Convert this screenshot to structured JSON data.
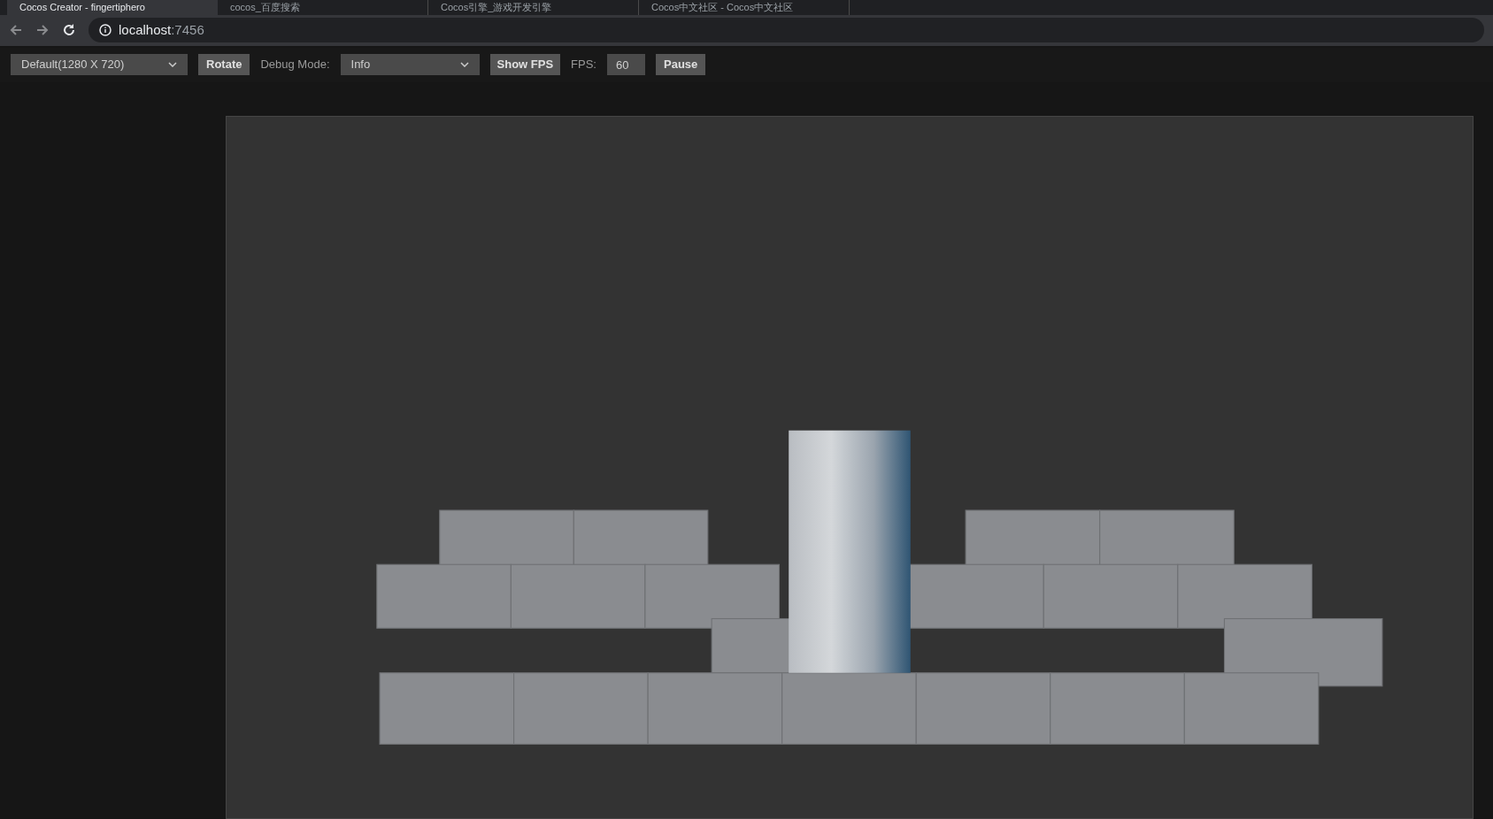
{
  "browser_tabs": [
    {
      "title": "Cocos Creator - fingertiphero",
      "selected": true
    },
    {
      "title": "cocos_百度搜索",
      "selected": false
    },
    {
      "title": "Cocos引擎_游戏开发引擎",
      "selected": false
    },
    {
      "title": "Cocos中文社区 - Cocos中文社区",
      "selected": false
    }
  ],
  "address_bar": {
    "host": "localhost",
    "port": ":7456"
  },
  "toolbar": {
    "resolution": "Default(1280 X 720)",
    "rotate": "Rotate",
    "debug_label": "Debug Mode:",
    "debug_mode": "Info",
    "show_fps": "Show FPS",
    "fps_label": "FPS:",
    "fps_value": "60",
    "pause": "Pause"
  }
}
